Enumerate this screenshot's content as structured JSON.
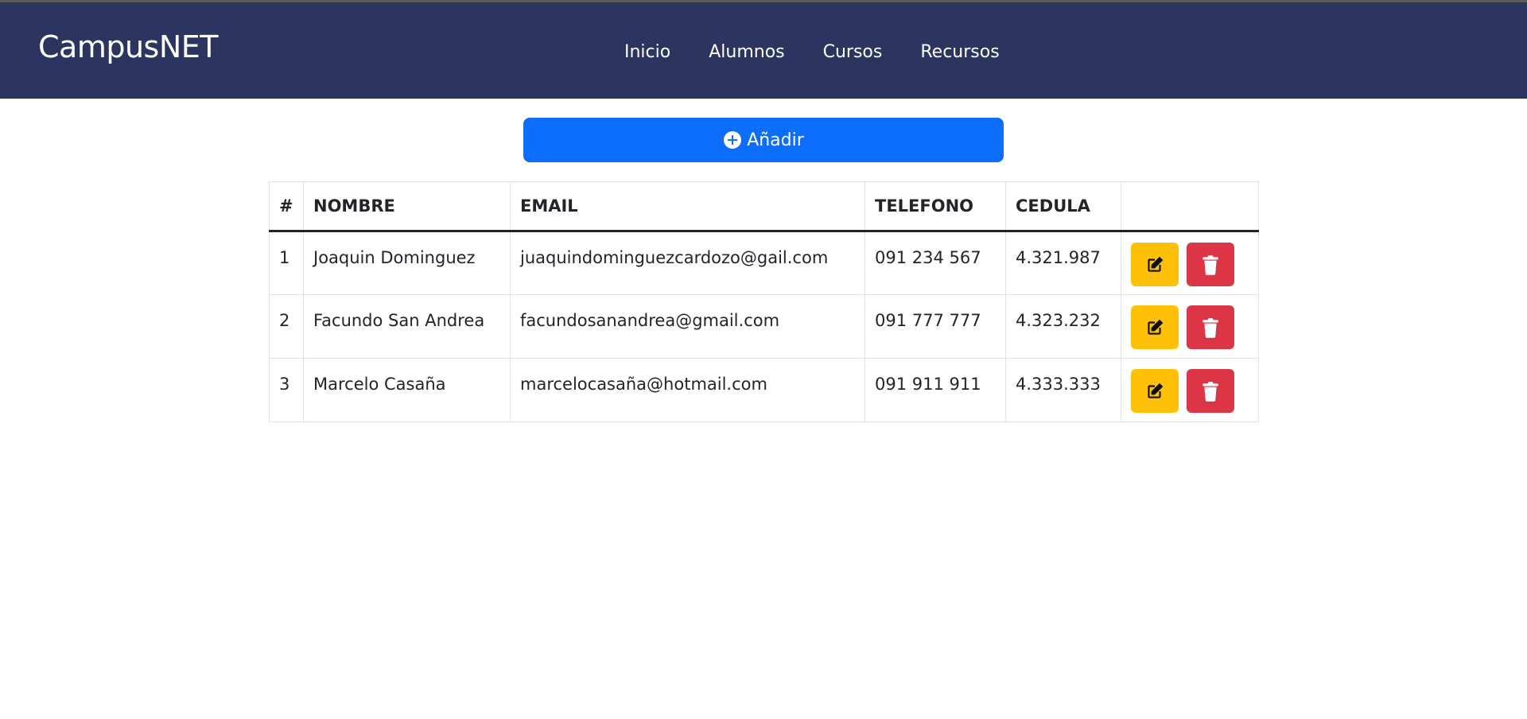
{
  "navbar": {
    "brand": "CampusNET",
    "links": [
      "Inicio",
      "Alumnos",
      "Cursos",
      "Recursos"
    ]
  },
  "add_button": {
    "label": "Añadir",
    "icon": "plus-circle-icon"
  },
  "table": {
    "headers": [
      "#",
      "NOMBRE",
      "EMAIL",
      "TELEFONO",
      "CEDULA",
      ""
    ],
    "rows": [
      {
        "num": "1",
        "nombre": "Joaquin Dominguez",
        "email": "juaquindominguezcardozo@gail.com",
        "telefono": "091 234 567",
        "cedula": "4.321.987"
      },
      {
        "num": "2",
        "nombre": "Facundo San Andrea",
        "email": "facundosanandrea@gmail.com",
        "telefono": "091 777 777",
        "cedula": "4.323.232"
      },
      {
        "num": "3",
        "nombre": "Marcelo Casaña",
        "email": "marcelocasaña@hotmail.com",
        "telefono": "091 911 911",
        "cedula": "4.333.333"
      }
    ]
  },
  "colors": {
    "navbar": "#2b355f",
    "primary": "#0d6efd",
    "warning": "#ffc107",
    "danger": "#dc3545"
  }
}
